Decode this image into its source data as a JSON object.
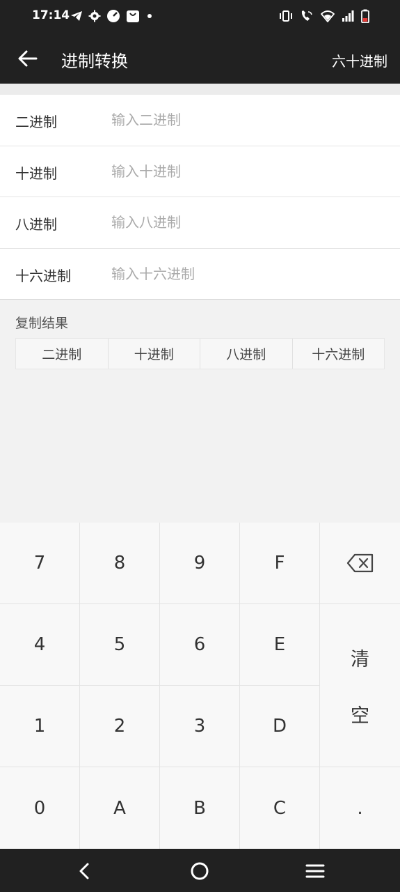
{
  "status": {
    "time": "17:14",
    "left_icons": [
      "telegram-icon",
      "gear-icon",
      "speed-icon",
      "bag-icon",
      "dot-icon"
    ],
    "right_icons": [
      "vibrate-icon",
      "wifi-call-icon",
      "wifi-icon",
      "signal-icon",
      "battery-icon"
    ]
  },
  "appbar": {
    "title": "进制转换",
    "action": "六十进制"
  },
  "fields": [
    {
      "label": "二进制",
      "placeholder": "输入二进制",
      "value": ""
    },
    {
      "label": "十进制",
      "placeholder": "输入十进制",
      "value": ""
    },
    {
      "label": "八进制",
      "placeholder": "输入八进制",
      "value": ""
    },
    {
      "label": "十六进制",
      "placeholder": "输入十六进制",
      "value": ""
    }
  ],
  "copy": {
    "title": "复制结果",
    "buttons": [
      "二进制",
      "十进制",
      "八进制",
      "十六进制"
    ]
  },
  "keypad": {
    "keys": [
      "7",
      "8",
      "9",
      "F",
      "4",
      "5",
      "6",
      "E",
      "1",
      "2",
      "3",
      "D",
      "0",
      "A",
      "B",
      "C",
      "."
    ],
    "backspace": "backspace-icon",
    "clear_top": "清",
    "clear_bottom": "空"
  },
  "nav": [
    "back-icon",
    "home-icon",
    "menu-icon"
  ],
  "colors": {
    "bar": "#212121",
    "background": "#f2f2f2",
    "keypad": "#f8f8f8"
  }
}
